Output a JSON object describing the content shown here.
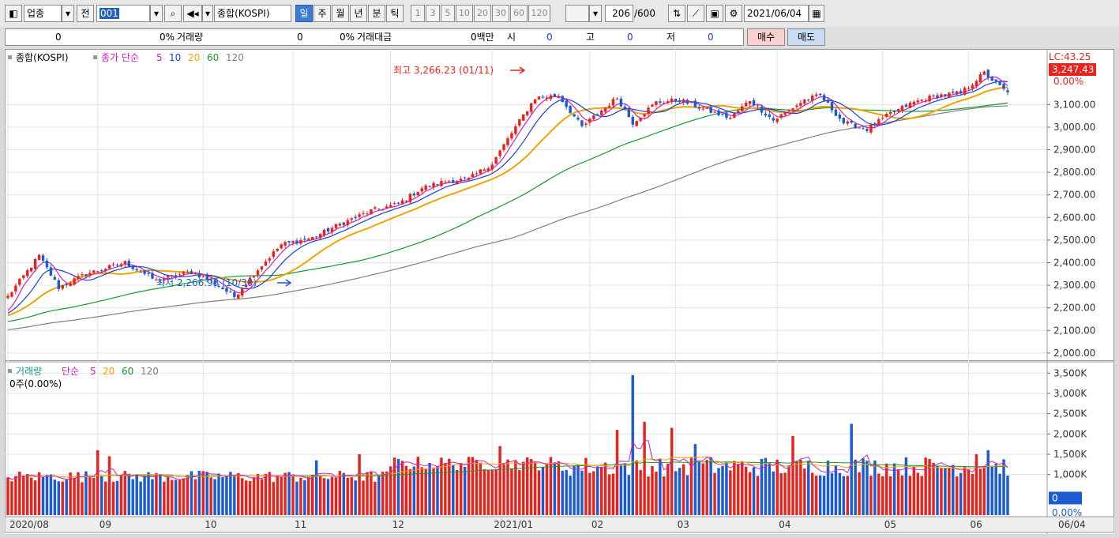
{
  "toolbar": {
    "category": "업종",
    "prev_label": "전",
    "code": "001",
    "index_name": "종합(KOSPI)",
    "periods": [
      "일",
      "주",
      "월",
      "년",
      "분",
      "틱"
    ],
    "active_period": "일",
    "numbers": [
      "1",
      "3",
      "5",
      "10",
      "20",
      "30",
      "60",
      "120"
    ],
    "count": "206",
    "count_total": "/600",
    "date": "2021/06/04"
  },
  "quote": {
    "value": "0",
    "change_pct": "0%",
    "volume_label": "거래량",
    "volume": "0",
    "volume_pct": "0%",
    "amount_label": "거래대금",
    "amount": "0백만",
    "open_label": "시",
    "open": "0",
    "high_label": "고",
    "high": "0",
    "low_label": "저",
    "low": "0",
    "buy_label": "매수",
    "sell_label": "매도"
  },
  "colors": {
    "up": "#e8231d",
    "down": "#1b5bd3",
    "ma5": "#d020c0",
    "ma10": "#1b3fd3",
    "ma20": "#f0a400",
    "ma60": "#169a2a",
    "ma120": "#808080"
  },
  "chart_data": [
    {
      "type": "candlestick",
      "legend": {
        "name": "종합(KOSPI)",
        "ma_label": "종가 단순",
        "periods": [
          "5",
          "10",
          "20",
          "60",
          "120"
        ]
      },
      "y_ticks": [
        "3,100.00",
        "3,000.00",
        "2,900.00",
        "2,800.00",
        "2,700.00",
        "2,600.00",
        "2,500.00",
        "2,400.00",
        "2,300.00",
        "2,200.00",
        "2,100.00",
        "2,000.00"
      ],
      "ylim": [
        1975,
        3325
      ],
      "lc_label": "LC:43.25",
      "last_price": "3,247.43",
      "last_pct": "0.00%",
      "annotations": {
        "high": "최고 3,266.23 (01/11)",
        "low": "최저 2,266.93 (10/30)"
      },
      "anchors": [
        [
          0,
          2250
        ],
        [
          8,
          2430
        ],
        [
          13,
          2290
        ],
        [
          20,
          2350
        ],
        [
          30,
          2400
        ],
        [
          38,
          2320
        ],
        [
          47,
          2360
        ],
        [
          52,
          2320
        ],
        [
          58,
          2250
        ],
        [
          64,
          2370
        ],
        [
          70,
          2480
        ],
        [
          78,
          2510
        ],
        [
          85,
          2570
        ],
        [
          93,
          2630
        ],
        [
          100,
          2660
        ],
        [
          106,
          2730
        ],
        [
          112,
          2760
        ],
        [
          118,
          2770
        ],
        [
          124,
          2840
        ],
        [
          130,
          3000
        ],
        [
          135,
          3130
        ],
        [
          141,
          3140
        ],
        [
          147,
          3000
        ],
        [
          151,
          3060
        ],
        [
          156,
          3130
        ],
        [
          160,
          3020
        ],
        [
          166,
          3110
        ],
        [
          172,
          3120
        ],
        [
          178,
          3080
        ],
        [
          185,
          3040
        ],
        [
          190,
          3120
        ],
        [
          196,
          3030
        ],
        [
          204,
          3120
        ],
        [
          208,
          3140
        ],
        [
          214,
          3020
        ],
        [
          220,
          2990
        ],
        [
          226,
          3060
        ],
        [
          232,
          3110
        ],
        [
          238,
          3140
        ],
        [
          244,
          3150
        ],
        [
          250,
          3240
        ],
        [
          256,
          3150
        ]
      ]
    },
    {
      "type": "bar",
      "legend": {
        "name": "거래량",
        "ma_label": "단순",
        "periods": [
          "5",
          "20",
          "60",
          "120"
        ]
      },
      "sublabel": "0주(0.00%)",
      "y_ticks": [
        "3,500K",
        "3,000K",
        "2,500K",
        "2,000K",
        "1,500K",
        "1,000K"
      ],
      "ylim": [
        0,
        3700
      ],
      "last_value": "0",
      "last_pct": "0.00%",
      "x_ticks": [
        {
          "label": "2020/08",
          "index": 0
        },
        {
          "label": "09",
          "index": 23
        },
        {
          "label": "10",
          "index": 50
        },
        {
          "label": "11",
          "index": 73
        },
        {
          "label": "12",
          "index": 98
        },
        {
          "label": "2021/01",
          "index": 124
        },
        {
          "label": "02",
          "index": 149
        },
        {
          "label": "03",
          "index": 171
        },
        {
          "label": "04",
          "index": 197
        },
        {
          "label": "05",
          "index": 224
        },
        {
          "label": "06",
          "index": 246
        }
      ],
      "last_date": "06/04",
      "spikes": [
        [
          23,
          1600
        ],
        [
          26,
          1450
        ],
        [
          79,
          1350
        ],
        [
          90,
          1500
        ],
        [
          126,
          1700
        ],
        [
          156,
          2100
        ],
        [
          160,
          3450
        ],
        [
          163,
          2300
        ],
        [
          170,
          2150
        ],
        [
          176,
          1750
        ],
        [
          201,
          1950
        ],
        [
          216,
          2250
        ],
        [
          248,
          1500
        ],
        [
          251,
          1600
        ]
      ]
    }
  ]
}
